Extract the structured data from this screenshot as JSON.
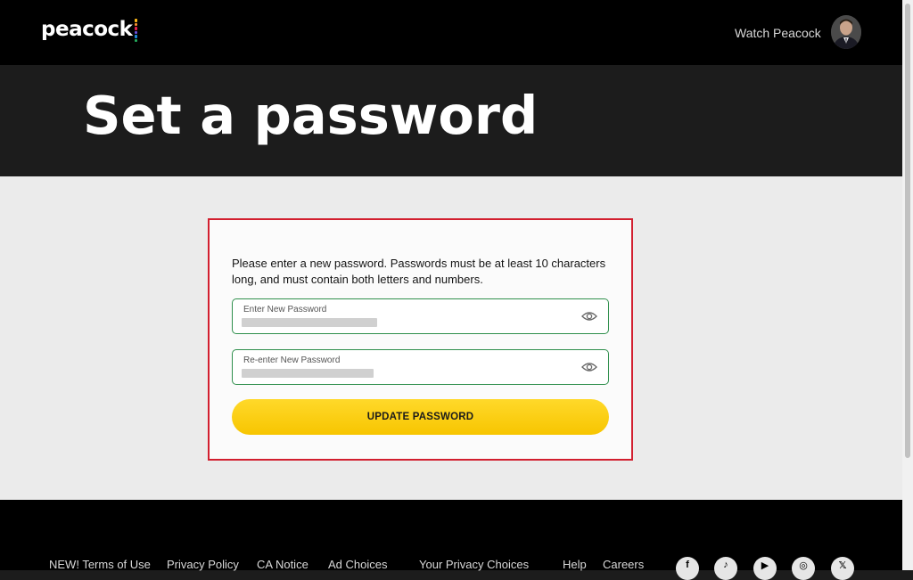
{
  "header": {
    "logo_text": "peacock",
    "logo_dot_colors": [
      "#f9b617",
      "#f68d2e",
      "#e0204c",
      "#6a4ed8",
      "#1c86d6",
      "#23a85a"
    ],
    "watch_link": "Watch Peacock",
    "avatar_icon": "user-avatar"
  },
  "hero": {
    "title": "Set a password"
  },
  "form": {
    "instructions": "Please enter a new password. Passwords must be at least 10 characters long, and must contain both letters and numbers.",
    "new_password_label": "Enter New Password",
    "reenter_password_label": "Re-enter New Password",
    "submit_label": "UPDATE PASSWORD",
    "eye_icon": "eye-icon",
    "accent_color": "#f7c500",
    "field_border_color": "#2f8f4c",
    "highlight_color": "#d21f2f"
  },
  "footer": {
    "links": [
      "NEW! Terms of Use",
      "Privacy Policy",
      "CA Notice",
      "Ad Choices",
      "Your Privacy Choices",
      "Help",
      "Careers"
    ],
    "social_icons": [
      "facebook-icon",
      "tiktok-icon",
      "youtube-icon",
      "instagram-icon",
      "x-icon"
    ]
  }
}
